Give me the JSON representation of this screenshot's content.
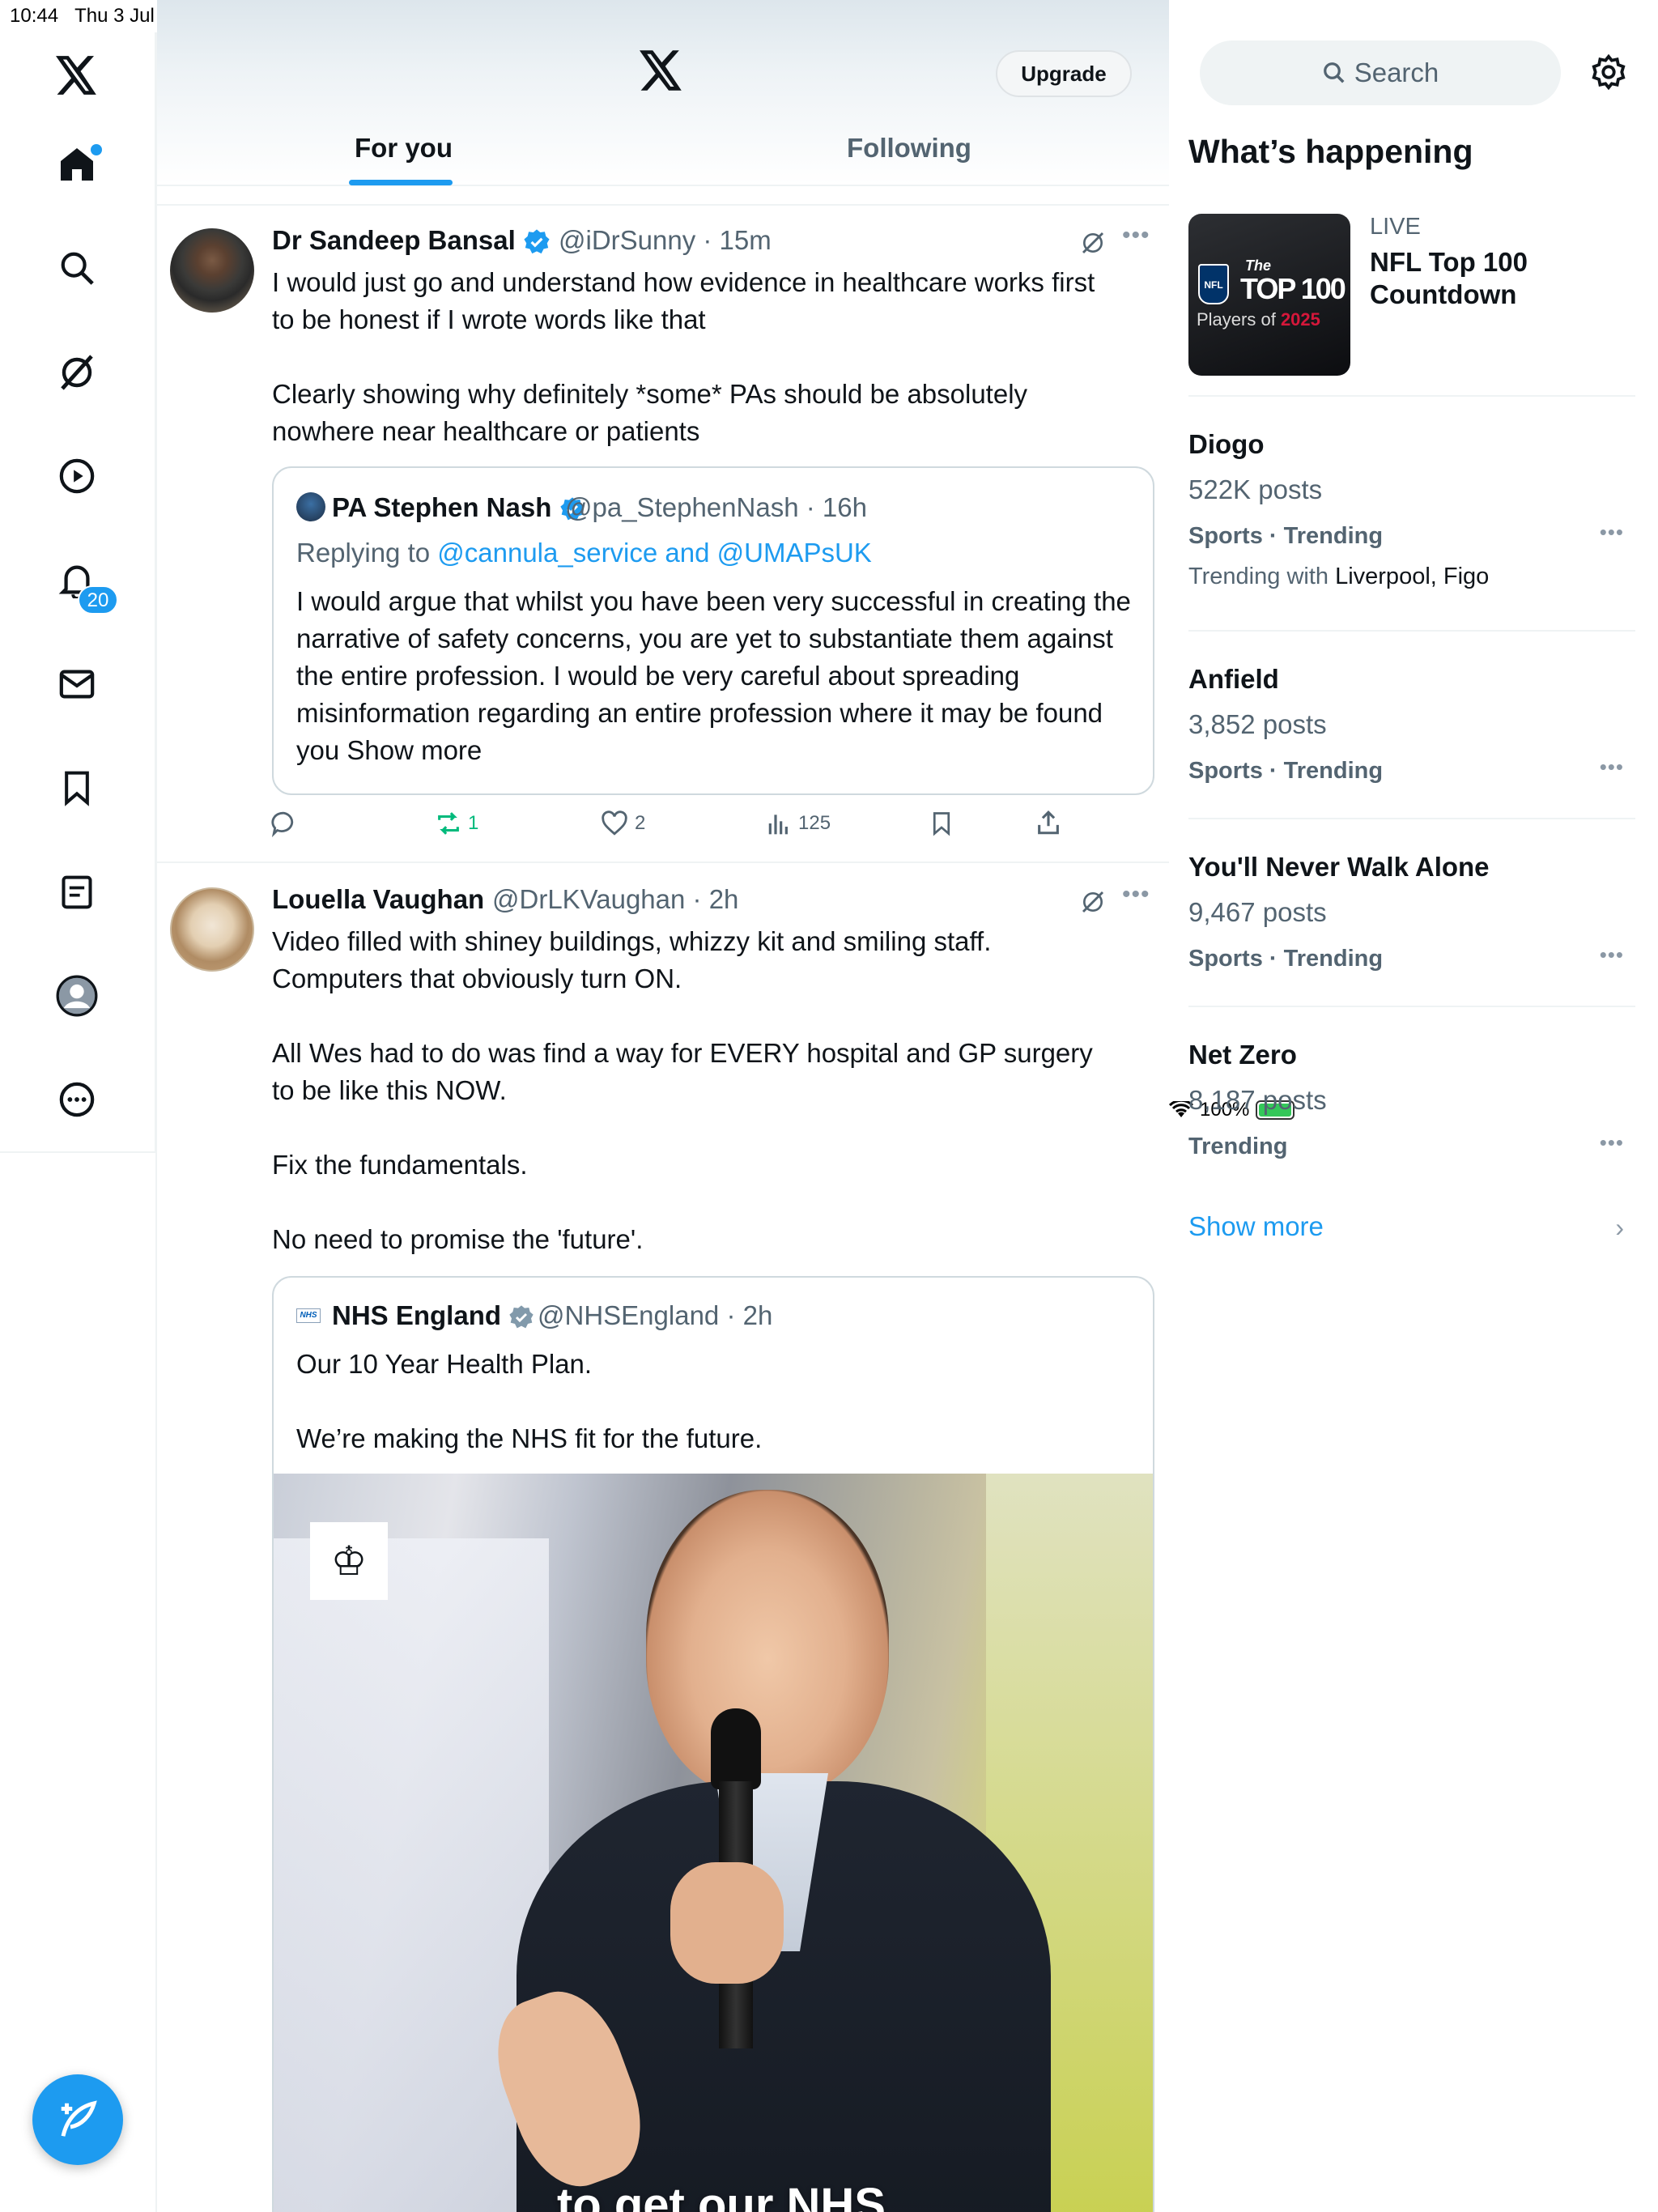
{
  "status_bar": {
    "time": "10:44",
    "date": "Thu 3 Jul",
    "battery": "100%",
    "dots": "•••"
  },
  "nav": {
    "logo_icon": "x-logo-icon",
    "items": [
      {
        "name": "home",
        "icon": "home-icon"
      },
      {
        "name": "explore",
        "icon": "search-icon"
      },
      {
        "name": "grok",
        "icon": "grok-icon"
      },
      {
        "name": "video",
        "icon": "play-icon"
      },
      {
        "name": "notifications",
        "icon": "bell-icon",
        "badge": "20"
      },
      {
        "name": "messages",
        "icon": "mail-icon"
      },
      {
        "name": "bookmarks",
        "icon": "bookmark-icon"
      },
      {
        "name": "lists",
        "icon": "list-icon"
      },
      {
        "name": "profile",
        "icon": "profile-icon"
      },
      {
        "name": "more",
        "icon": "more-icon"
      }
    ],
    "compose_icon": "compose-icon"
  },
  "header": {
    "upgrade_label": "Upgrade",
    "tabs": [
      {
        "label": "For you",
        "active": true
      },
      {
        "label": "Following",
        "active": false
      }
    ]
  },
  "tweets": [
    {
      "name": "Dr Sandeep Bansal",
      "handle": "@iDrSunny · 15m",
      "body": "I would just go and understand how evidence in healthcare works first to be honest if I wrote words like that\n\nClearly showing why definitely *some* PAs should be absolutely nowhere near healthcare or patients",
      "quote": {
        "name": "PA Stephen Nash",
        "handle": "@pa_StephenNash · 16h",
        "replying_prefix": "Replying to ",
        "replying_to": "@cannula_service and @UMAPsUK",
        "body": "I would argue that whilst you have been very successful in creating the narrative of safety concerns, you are yet to substantiate them against the entire profession. I would be very careful about spreading misinformation regarding an entire profession where it may be found you Show more"
      },
      "actions": {
        "replies": "",
        "reposts": "1",
        "likes": "2",
        "views": "125"
      }
    },
    {
      "name": "Louella Vaughan",
      "handle": "@DrLKVaughan · 2h",
      "body": "Video filled with shiney buildings, whizzy kit and smiling staff. Computers that obviously turn ON.\n\nAll Wes had to do was find a way for EVERY hospital and GP surgery to be like this NOW.\n\nFix the fundamentals.\n\nNo need to promise the 'future'.",
      "quote": {
        "name": "NHS England",
        "handle": "@NHSEngland · 2h",
        "body": "Our 10 Year Health Plan.\n\nWe’re making the NHS fit for the future.",
        "video_caption": "to get our NHS"
      }
    }
  ],
  "sidebar": {
    "search_placeholder": "Search",
    "title": "What’s happening",
    "live": {
      "label": "LIVE",
      "title": "NFL Top 100 Countdown",
      "thumb_top": "The",
      "thumb_main": "TOP 100",
      "thumb_sub": "Players of ",
      "thumb_year": "2025"
    },
    "trends": [
      {
        "name": "Diogo",
        "posts": "522K posts",
        "category": "Sports · Trending",
        "with_prefix": "Trending with ",
        "with": "Liverpool, Figo"
      },
      {
        "name": "Anfield",
        "posts": "3,852 posts",
        "category": "Sports · Trending"
      },
      {
        "name": "You'll Never Walk Alone",
        "posts": "9,467 posts",
        "category": "Sports · Trending"
      },
      {
        "name": "Net Zero",
        "posts": "8,187 posts",
        "category": "Trending"
      }
    ],
    "show_more": "Show more"
  },
  "colors": {
    "accent": "#1d9bf0",
    "repost_active": "#00ba7c",
    "text": "#0f1419",
    "muted": "#536471"
  }
}
